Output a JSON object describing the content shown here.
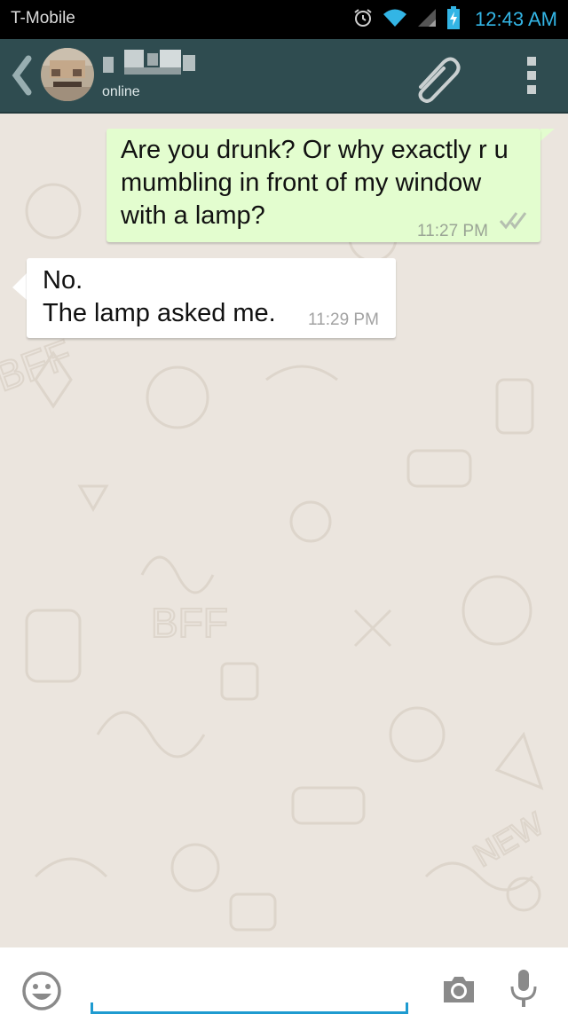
{
  "status_bar": {
    "carrier": "T-Mobile",
    "time": "12:43 AM",
    "icons": [
      "alarm-icon",
      "wifi-icon",
      "signal-icon",
      "battery-charging-icon"
    ]
  },
  "header": {
    "contact_status": "online",
    "icons": [
      "back-chevron-icon",
      "contact-avatar",
      "attach-paperclip-icon",
      "overflow-menu-icon"
    ]
  },
  "messages": [
    {
      "direction": "outgoing",
      "lines": [
        "Are you drunk? Or why exactly r u",
        "mumbling in front of my window",
        "with a lamp?"
      ],
      "time": "11:27 PM",
      "status": "double-check-icon"
    },
    {
      "direction": "incoming",
      "lines": [
        "No.",
        "The lamp asked me."
      ],
      "time": "11:29 PM"
    }
  ],
  "input_bar": {
    "message_value": "",
    "icons": [
      "emoji-icon",
      "camera-icon",
      "microphone-icon"
    ]
  },
  "colors": {
    "status_bar_bg": "#000000",
    "clock": "#33b5e5",
    "action_bar_bg": "#2f4c50",
    "outgoing_bubble": "#e3fdcf",
    "incoming_bubble": "#ffffff",
    "chat_bg": "#ebe5de",
    "input_underline": "#1f9bd0"
  }
}
